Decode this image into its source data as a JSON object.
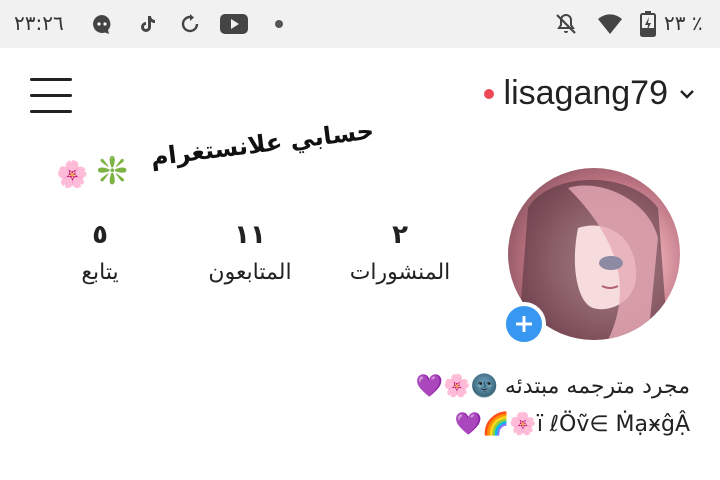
{
  "status_bar": {
    "time": "٢٣:٢٦",
    "battery_percent": "٢٣ ٪",
    "left_icons": [
      "chat-bubble-icon",
      "tiktok-icon",
      "sync-icon",
      "youtube-icon",
      "dot-icon"
    ],
    "right_icons": [
      "muted-bell-icon",
      "wifi-icon",
      "battery-charging-icon"
    ]
  },
  "header": {
    "username": "lisagang79",
    "live_dot_color": "#ed4956"
  },
  "sticker": {
    "title": "حسابي علانستغرام",
    "emojis": [
      "🌸",
      "❇️"
    ]
  },
  "stats": {
    "posts": {
      "value": "٢",
      "label": "المنشورات"
    },
    "followers": {
      "value": "١١",
      "label": "المتابعون"
    },
    "following": {
      "value": "٥",
      "label": "يتابع"
    }
  },
  "bio": {
    "line1": "مجرد مترجمه مبتدئه 🌚🌸💜",
    "line2": "ï ℓÖṽ∈ ṀạӿĝẬ🌸🌈💜"
  },
  "colors": {
    "accent_blue": "#3897f0"
  }
}
